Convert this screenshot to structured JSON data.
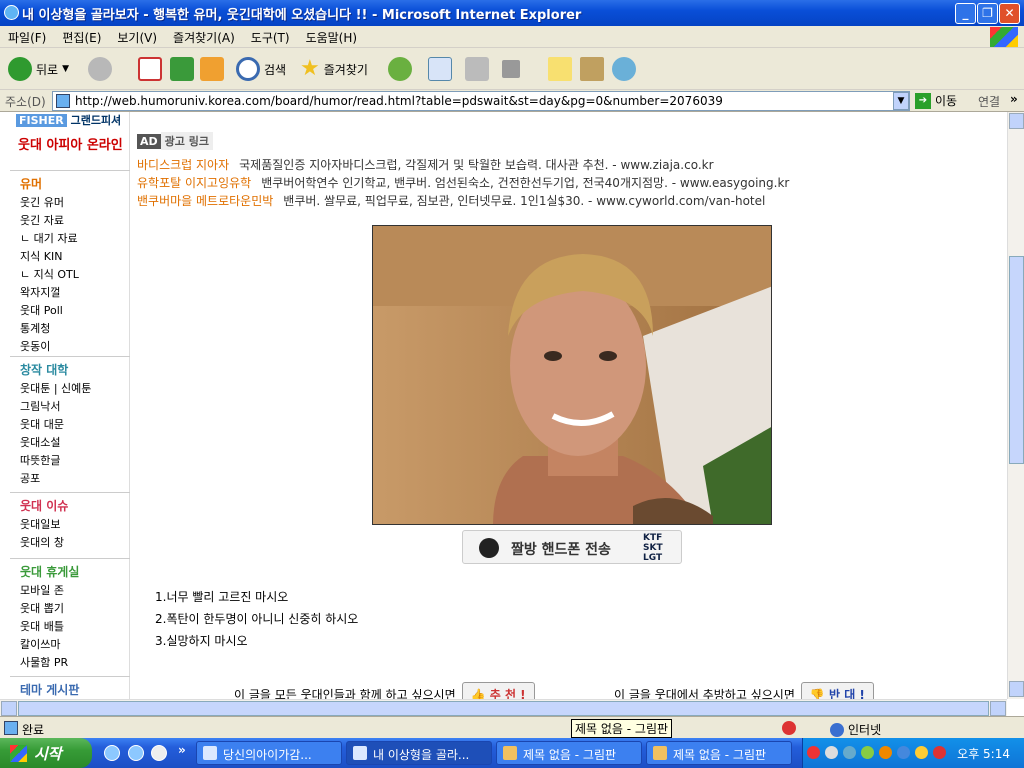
{
  "window": {
    "title": "내 이상형을 골라보자 - 행복한 유머, 웃긴대학에 오셨습니다 !! - Microsoft Internet Explorer",
    "minimize": "_",
    "maximize": "❐",
    "close": "✕"
  },
  "menu": [
    "파일(F)",
    "편집(E)",
    "보기(V)",
    "즐겨찾기(A)",
    "도구(T)",
    "도움말(H)"
  ],
  "toolbar": {
    "back": "뒤로",
    "search": "검색",
    "favorites": "즐겨찾기"
  },
  "address": {
    "label": "주소(D)",
    "url": "http://web.humoruniv.korea.com/board/humor/read.html?table=pdswait&st=day&pg=0&number=2076039",
    "go": "이동",
    "links": "연결"
  },
  "sidebar": {
    "logo1": "그랜드피셔",
    "logo2": "웃대 아피아 온라인",
    "sections": [
      {
        "heading": "유머",
        "color": "#e07000",
        "items": [
          "웃긴 유머",
          "웃긴 자료",
          "ㄴ 대기 자료",
          "지식 KIN",
          "ㄴ 지식 OTL",
          "왁자지껄",
          "웃대 Poll",
          "통계청",
          "웃동이"
        ]
      },
      {
        "heading": "창작 대학",
        "color": "#2a8aa0",
        "items": [
          "웃대툰 | 신예툰",
          "그림낙서",
          "웃대 대문",
          "웃대소설",
          "따뜻한글",
          "공포"
        ]
      },
      {
        "heading": "웃대 이슈",
        "color": "#d03050",
        "items": [
          "웃대일보",
          "웃대의 창"
        ]
      },
      {
        "heading": "웃대 휴게실",
        "color": "#3a9a3a",
        "items": [
          "모바일 존",
          "웃대 뽑기",
          "웃대 배틀",
          "칼이쓰마",
          "사물함 PR"
        ]
      },
      {
        "heading": "테마 게시판",
        "color": "#3a6ab0",
        "items": []
      }
    ]
  },
  "ad": {
    "tag": "AD",
    "label": "광고 링크",
    "lines": [
      {
        "title": "바디스크럽 지아자",
        "desc": "국제품질인증 지아자바디스크럽, 각질제거 및 탁월한 보습력. 대사관 추천. - www.ziaja.co.kr"
      },
      {
        "title": "유학포탈 이지고잉유학",
        "desc": "밴쿠버어학연수 인기학교, 밴쿠버. 엄선된숙소, 건전한선두기업, 전국40개지점망. - www.easygoing.kr"
      },
      {
        "title": "밴쿠버마을 메트로타운민박",
        "desc": "밴쿠버. 쌀무료, 픽업무료, 짐보관, 인터넷무료. 1인1실$30. - www.cyworld.com/van-hotel"
      }
    ]
  },
  "sendbar": {
    "text": "짤방 핸드폰 전송",
    "ops": [
      "KTF",
      "SKT",
      "LGT"
    ]
  },
  "rules": [
    "1.너무 빨리 고르진 마시오",
    "2.폭탄이 한두명이 아니니 신중히 하시오",
    "3.실망하지 마시오"
  ],
  "vote": {
    "up_text": "이 글을 모든 웃대인들과 함께 하고 싶으시면",
    "up_btn": "추 천 !",
    "down_text": "이 글을 웃대에서 추방하고 싶으시면",
    "down_btn": "반 대 !"
  },
  "status": {
    "text": "완료",
    "tooltip": "제목 없음 - 그림판",
    "zone": "인터넷"
  },
  "taskbar": {
    "start": "시작",
    "tasks": [
      "당신의아이가감...",
      "내 이상형을 골라...",
      "제목 없음 - 그림판",
      "제목 없음 - 그림판"
    ],
    "chevron": "»",
    "clock": "오후 5:14"
  }
}
